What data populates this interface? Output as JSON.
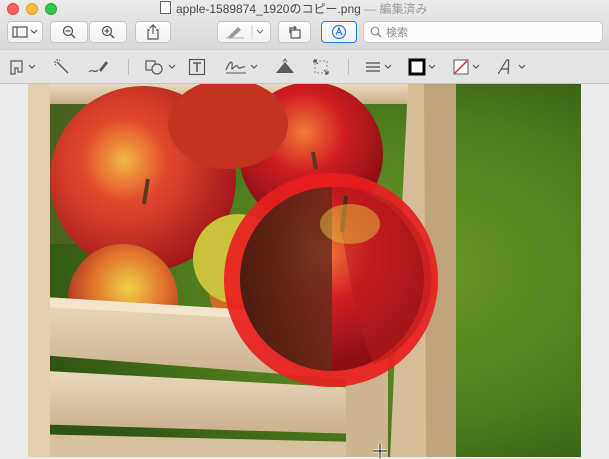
{
  "window": {
    "filename": "apple-1589874_1920のコピー.png",
    "separator": " — ",
    "status": "編集済み"
  },
  "toolbar": {
    "buttons": [
      {
        "name": "sidebar-toggle-button",
        "icon": "sidebar-icon"
      },
      {
        "name": "zoom-out-button",
        "icon": "zoom-out-icon"
      },
      {
        "name": "zoom-in-button",
        "icon": "zoom-in-icon"
      },
      {
        "name": "share-button",
        "icon": "share-icon"
      },
      {
        "name": "highlight-button",
        "icon": "pen-icon"
      },
      {
        "name": "rotate-button",
        "icon": "rotate-icon"
      },
      {
        "name": "markup-button",
        "icon": "markup-icon"
      }
    ],
    "search_placeholder": "検索"
  },
  "markup_tools": [
    "rectangular-selection-icon",
    "instant-alpha-icon",
    "sketch-icon",
    "shapes-icon",
    "text-icon",
    "sign-icon",
    "adjust-color-icon",
    "adjust-size-icon",
    "shape-style-icon",
    "border-color-icon",
    "fill-color-icon",
    "text-style-icon"
  ],
  "colors": {
    "accent": "#2f7ae5",
    "border_color_swatch": "#000000",
    "selection_outline": "#e8201e"
  }
}
